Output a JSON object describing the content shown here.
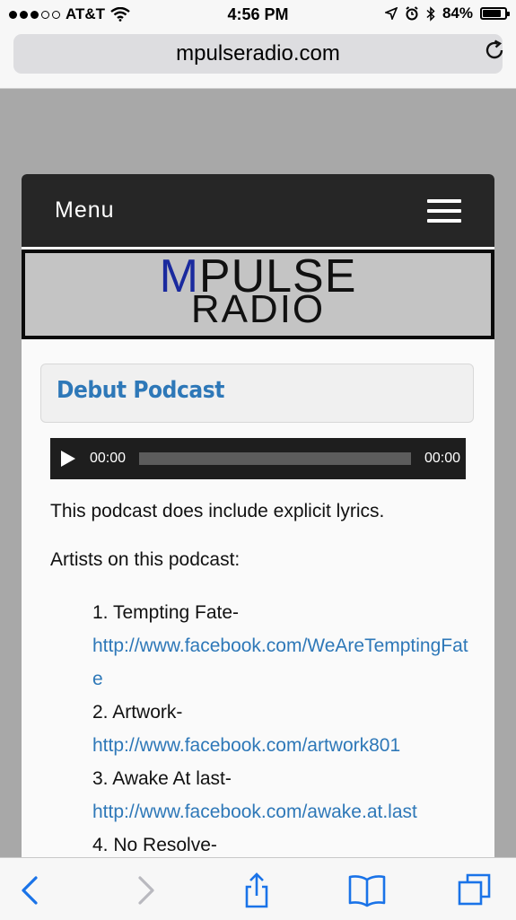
{
  "status_bar": {
    "carrier": "AT&T",
    "time": "4:56 PM",
    "battery_percent": "84%",
    "battery_level": 0.84,
    "signal_bars": 3,
    "signal_total": 5
  },
  "browser": {
    "url": "mpulseradio.com"
  },
  "site": {
    "menu_label": "Menu",
    "logo_m": "M",
    "logo_pulse": "PULSE",
    "logo_radio": "RADIO"
  },
  "post": {
    "title": "Debut Podcast",
    "player": {
      "current_time": "00:00",
      "duration": "00:00"
    },
    "paragraph1": "This podcast does include explicit lyrics.",
    "paragraph2": "Artists on this podcast:",
    "artists": [
      {
        "name": "1. Tempting Fate-",
        "link": "http://www.facebook.com/WeAreTemptingFate"
      },
      {
        "name": "2. Artwork-",
        "link": "http://www.facebook.com/artwork801"
      },
      {
        "name": "3. Awake At last-",
        "link": "http://www.facebook.com/awake.at.last"
      },
      {
        "name": "4. No Resolve-"
      }
    ]
  },
  "colors": {
    "link": "#2e78b8",
    "menu_bar": "#262626",
    "logo_m": "#1a2a9e",
    "ios_tint": "#1a73e8"
  },
  "icons": {
    "reload": "reload-icon",
    "back": "back-chevron-icon",
    "forward": "forward-chevron-icon",
    "share": "share-icon",
    "bookmarks": "bookmarks-icon",
    "tabs": "tabs-icon"
  }
}
